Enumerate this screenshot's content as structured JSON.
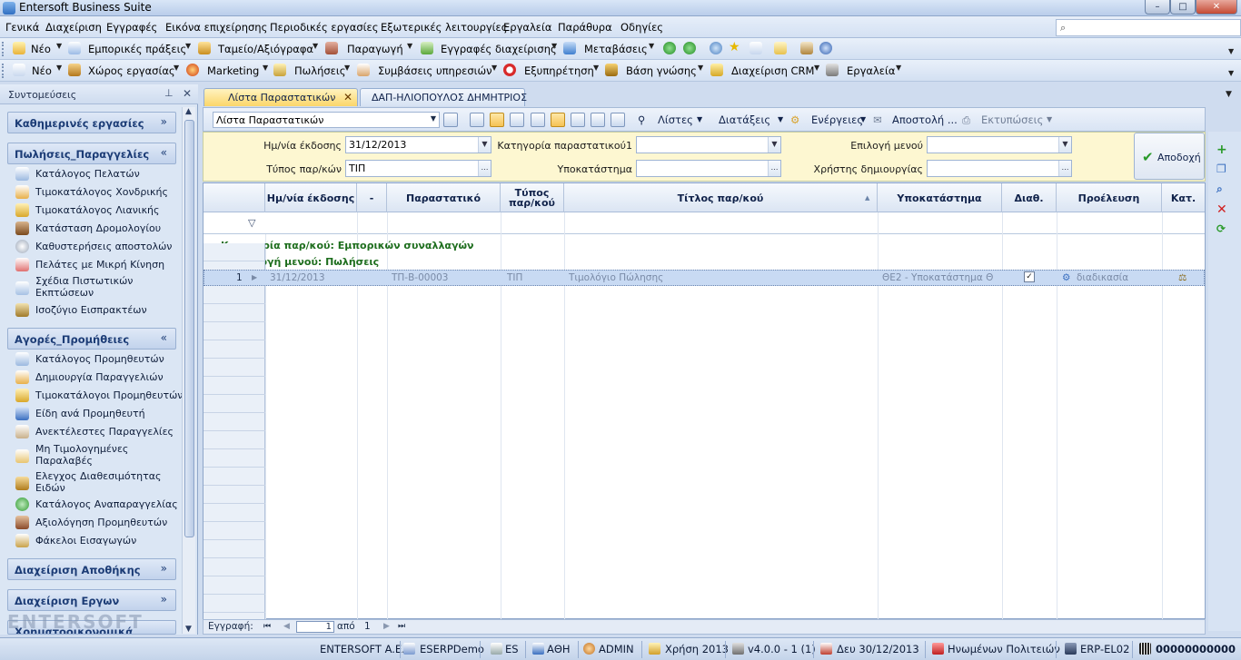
{
  "window": {
    "title": "Entersoft Business Suite",
    "controls": {
      "minimize": "–",
      "maximize": "□",
      "close": "✕"
    }
  },
  "menubar": {
    "items": [
      "Γενικά",
      "Διαχείριση",
      "Εγγραφές",
      "Εικόνα επιχείρησης",
      "Περιοδικές εργασίες",
      "Εξωτερικές λειτουργίες",
      "Εργαλεία",
      "Παράθυρα",
      "Οδηγίες"
    ]
  },
  "toolbar1": {
    "items": [
      "Νέο",
      "Εμπορικές πράξεις",
      "Ταμείο/Αξιόγραφα",
      "Παραγωγή",
      "Εγγραφές διαχείρισης",
      "Μεταβάσεις"
    ]
  },
  "toolbar2": {
    "items": [
      "Νέο",
      "Χώρος εργασίας",
      "Marketing",
      "Πωλήσεις",
      "Συμβάσεις υπηρεσιών",
      "Εξυπηρέτηση",
      "Βάση γνώσης",
      "Διαχείριση CRM",
      "Εργαλεία"
    ]
  },
  "sidebar": {
    "title": "Συντομεύσεις",
    "groups": [
      {
        "label": "Καθημερινές εργασίες",
        "collapsed": true
      },
      {
        "label": "Πωλήσεις_Παραγγελίες",
        "collapsed": false,
        "items": [
          "Κατάλογος Πελατών",
          "Τιμοκατάλογος Χονδρικής",
          "Τιμοκατάλογος Λιανικής",
          "Κατάσταση Δρομολογίου",
          "Καθυστερήσεις αποστολών",
          "Πελάτες με Μικρή Κίνηση",
          "Σχέδια Πιστωτικών Εκπτώσεων",
          "Ισοζύγιο Εισπρακτέων"
        ]
      },
      {
        "label": "Αγορές_Προμήθειες",
        "collapsed": false,
        "items": [
          "Κατάλογος Προμηθευτών",
          "Δημιουργία Παραγγελιών",
          "Τιμοκατάλογοι Προμηθευτών",
          "Είδη ανά Προμηθευτή",
          "Ανεκτέλεστες Παραγγελίες",
          "Μη Τιμολογημένες Παραλαβές",
          "Ελεγχος Διαθεσιμότητας Ειδών",
          "Κατάλογος Αναπαραγγελίας",
          "Αξιολόγηση Προμηθευτών",
          "Φάκελοι Εισαγωγών"
        ]
      },
      {
        "label": "Διαχείριση Αποθήκης",
        "collapsed": true
      },
      {
        "label": "Διαχείριση Εργων",
        "collapsed": true
      },
      {
        "label": "Χρηματοοικονομικά",
        "collapsed": true
      }
    ],
    "logo_text": "ENTERSOFT"
  },
  "tabs": [
    {
      "label": "Λίστα Παραστατικών",
      "active": true
    },
    {
      "label": "ΔΑΠ-ΗΛΙΟΠΟΥΛΟΣ ΔΗΜΗΤΡΙΟΣ",
      "active": false
    }
  ],
  "doc_toolbar": {
    "view_select": "Λίστα Παραστατικών",
    "lists": "Λίστες",
    "sorts": "Διατάξεις",
    "actions": "Ενέργειες",
    "send": "Αποστολή ...",
    "prints": "Εκτυπώσεις"
  },
  "filters": {
    "issue_date_label": "Ημ/νία έκδοσης",
    "issue_date_value": "31/12/2013",
    "doc_type_label": "Τύπος παρ/κών",
    "doc_type_value": "ΤΙΠ",
    "category_label": "Κατηγορία παραστατικού1",
    "category_value": "",
    "branch_label": "Υποκατάστημα",
    "branch_value": "",
    "menu_label": "Επιλογή μενού",
    "menu_value": "",
    "creator_label": "Χρήστης δημιουργίας",
    "creator_value": "",
    "accept": "Αποδοχή"
  },
  "grid": {
    "columns": [
      "Ημ/νία έκδοσης",
      "-",
      "Παραστατικό",
      "Τύπος παρ/κού",
      "Τίτλος παρ/κού",
      "Υποκατάστημα",
      "Διαθ.",
      "Προέλευση",
      "Κατ."
    ],
    "group1": "Κατηγορία παρ/κού:  Εμπορικών συναλλαγών",
    "group2": "Επιλογή μενού:  Πωλήσεις",
    "rows": [
      {
        "num": "1",
        "date": "31/12/2013",
        "doc": "ΤΠ-Β-00003",
        "type": "ΤΙΠ",
        "title": "Τιμολόγιο Πώλησης",
        "branch": "ΘΕ2 - Υποκατάστημα Θ",
        "avail": true,
        "origin": "διαδικασία"
      }
    ],
    "footer": {
      "label": "Εγγραφή:",
      "page": "1",
      "of_label": "από",
      "total": "1"
    }
  },
  "statusbar": {
    "company": "ENTERSOFT A.E.",
    "database": "ESERPDemo",
    "language": "ES",
    "branch": "ΑΘΗ",
    "user": "ADMIN",
    "fiscal_year": "Χρήση 2013",
    "version": "v4.0.0 - 1 (1)",
    "date": "Δευ 30/12/2013",
    "address": "Ηνωμένων Πολιτειών",
    "server": "ERP-EL02",
    "code": "00000000000"
  }
}
